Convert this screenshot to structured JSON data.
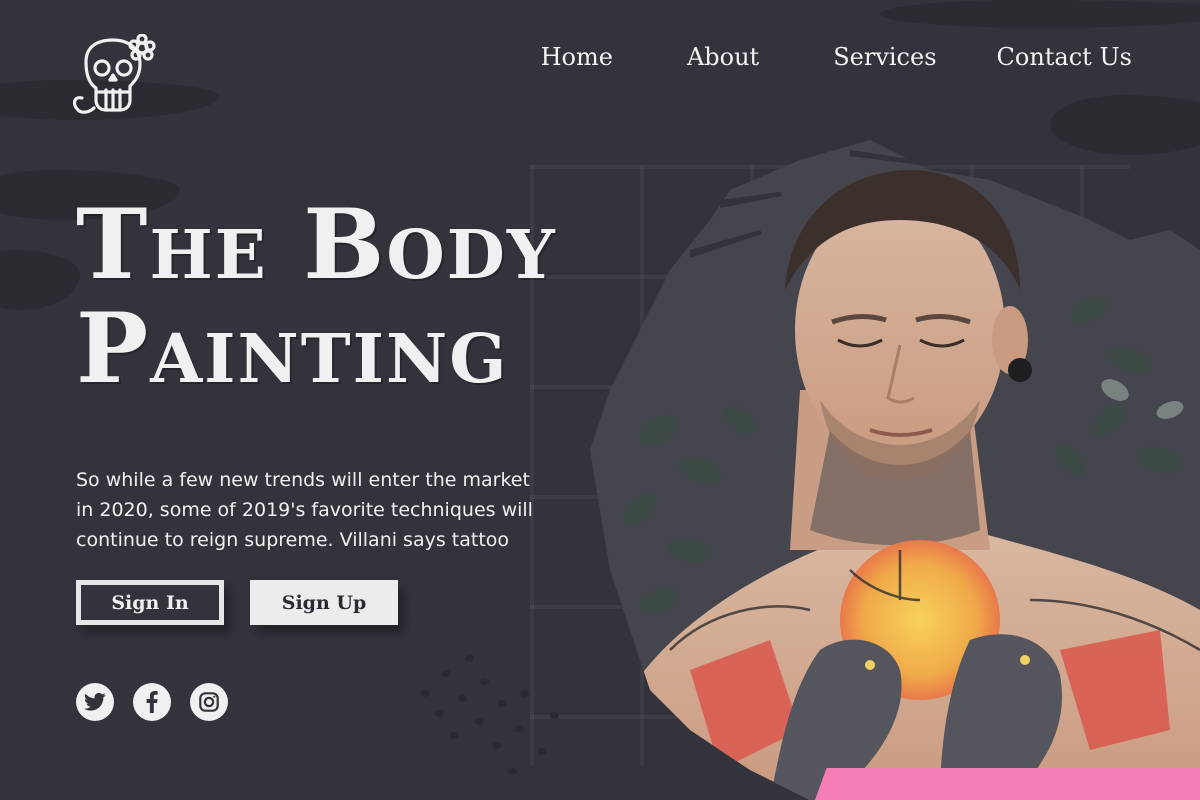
{
  "brand": {
    "logo_icon": "skull-flower-icon"
  },
  "nav": {
    "items": [
      {
        "label": "Home"
      },
      {
        "label": "About"
      },
      {
        "label": "Services"
      },
      {
        "label": "Contact Us"
      }
    ]
  },
  "hero": {
    "title_line1": "The Body",
    "title_line2": "Painting",
    "description": "So while a few new trends will enter the market in 2020, some of 2019's favorite techniques will continue to reign supreme. Villani says tattoo",
    "signin_label": "Sign In",
    "signup_label": "Sign Up"
  },
  "social": [
    {
      "icon": "twitter-icon"
    },
    {
      "icon": "facebook-icon"
    },
    {
      "icon": "instagram-icon"
    }
  ],
  "colors": {
    "background": "#33333c",
    "text": "#f0f0f0",
    "accent_pink": "#f47eb5"
  }
}
